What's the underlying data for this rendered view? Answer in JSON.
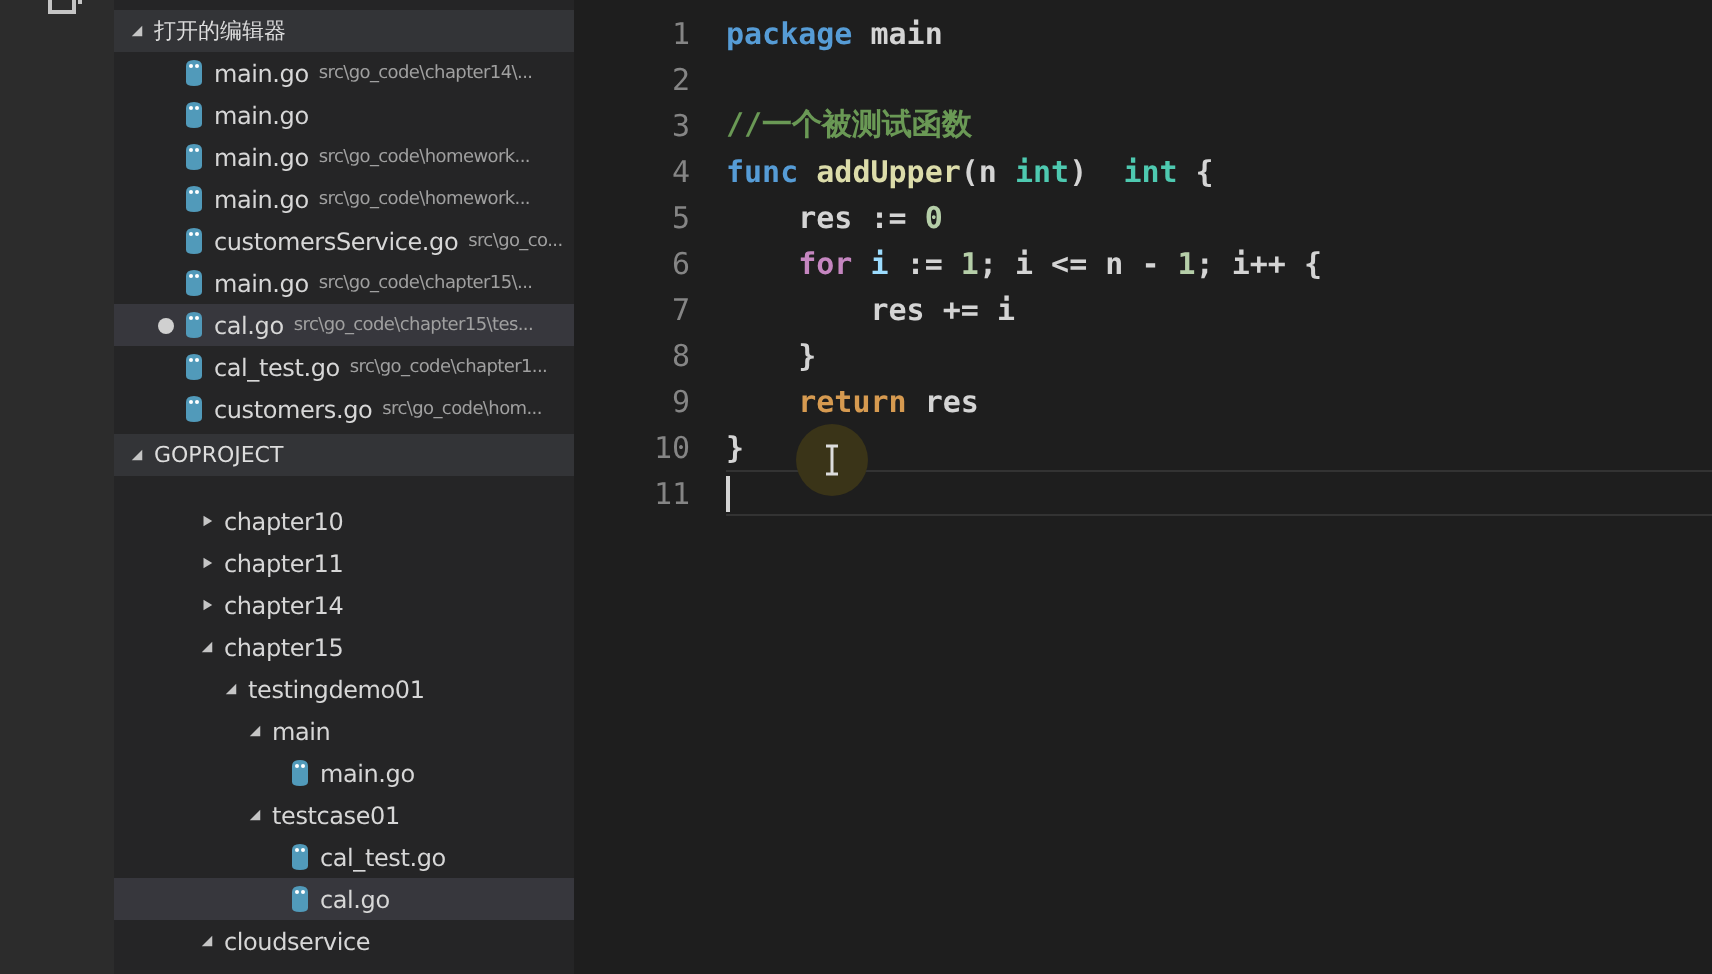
{
  "open_editors": {
    "title": "打开的编辑器",
    "expanded": true,
    "items": [
      {
        "name": "main.go",
        "path": "src\\go_code\\chapter14\\...",
        "modified": false,
        "selected": false
      },
      {
        "name": "main.go",
        "modified": false,
        "selected": false
      },
      {
        "name": "main.go",
        "path": "src\\go_code\\homework...",
        "modified": false,
        "selected": false
      },
      {
        "name": "main.go",
        "path": "src\\go_code\\homework...",
        "modified": false,
        "selected": false
      },
      {
        "name": "customersService.go",
        "path": "src\\go_co...",
        "modified": false,
        "selected": false
      },
      {
        "name": "main.go",
        "path": "src\\go_code\\chapter15\\...",
        "modified": false,
        "selected": false
      },
      {
        "name": "cal.go",
        "path": "src\\go_code\\chapter15\\tes...",
        "modified": true,
        "selected": true
      },
      {
        "name": "cal_test.go",
        "path": "src\\go_code\\chapter1...",
        "modified": false,
        "selected": false
      },
      {
        "name": "customers.go",
        "path": "src\\go_code\\hom...",
        "modified": false,
        "selected": false
      }
    ]
  },
  "project": {
    "title": "GOPROJECT",
    "expanded": true,
    "items": [
      {
        "kind": "folder",
        "name": "chapter10",
        "expanded": false,
        "selected": false
      },
      {
        "kind": "folder",
        "name": "chapter11",
        "expanded": false,
        "selected": false
      },
      {
        "kind": "folder",
        "name": "chapter14",
        "expanded": false,
        "selected": false
      },
      {
        "kind": "folder",
        "name": "chapter15",
        "expanded": true,
        "selected": false,
        "children": [
          {
            "kind": "folder",
            "name": "testingdemo01",
            "expanded": true,
            "selected": false,
            "children": [
              {
                "kind": "folder",
                "name": "main",
                "expanded": true,
                "selected": false,
                "children": [
                  {
                    "kind": "file",
                    "name": "main.go",
                    "selected": false
                  }
                ]
              },
              {
                "kind": "folder",
                "name": "testcase01",
                "expanded": true,
                "selected": false,
                "children": [
                  {
                    "kind": "file",
                    "name": "cal_test.go",
                    "selected": false
                  },
                  {
                    "kind": "file",
                    "name": "cal.go",
                    "selected": true
                  }
                ]
              }
            ]
          }
        ]
      },
      {
        "kind": "folder",
        "name": "cloudservice",
        "expanded": true,
        "selected": false
      }
    ]
  },
  "editor": {
    "lines": [
      {
        "number": "1",
        "tokens": [
          {
            "kind": "keyword",
            "text": "package"
          },
          {
            "kind": "plain",
            "text": " main"
          }
        ]
      },
      {
        "number": "2"
      },
      {
        "number": "3",
        "tokens": [
          {
            "kind": "comment",
            "text": "//一个被测试函数"
          }
        ]
      },
      {
        "number": "4",
        "tokens": [
          {
            "kind": "keyword",
            "text": "func "
          },
          {
            "kind": "function",
            "text": "addUpper"
          },
          {
            "kind": "plain",
            "text": "(n "
          },
          {
            "kind": "type",
            "text": "int"
          },
          {
            "kind": "plain",
            "text": ")  "
          },
          {
            "kind": "type",
            "text": "int"
          },
          {
            "kind": "plain",
            "text": " {"
          }
        ]
      },
      {
        "number": "5",
        "tokens": [
          {
            "kind": "plain",
            "text": "    res := "
          },
          {
            "kind": "number",
            "text": "0"
          }
        ]
      },
      {
        "number": "6",
        "tokens": [
          {
            "kind": "control",
            "text": "    for"
          },
          {
            "kind": "variable",
            "text": " i"
          },
          {
            "kind": "plain",
            "text": " := "
          },
          {
            "kind": "number",
            "text": "1"
          },
          {
            "kind": "plain",
            "text": "; i <= n - "
          },
          {
            "kind": "number",
            "text": "1"
          },
          {
            "kind": "plain",
            "text": "; i++ {"
          }
        ]
      },
      {
        "number": "7",
        "tokens": [
          {
            "kind": "plain",
            "text": "        res += i"
          }
        ]
      },
      {
        "number": "8",
        "tokens": [
          {
            "kind": "plain",
            "text": "    }"
          }
        ]
      },
      {
        "number": "9",
        "tokens": [
          {
            "kind": "return",
            "text": "    return"
          },
          {
            "kind": "plain",
            "text": " res"
          }
        ]
      },
      {
        "number": "10",
        "tokens": [
          {
            "kind": "plain",
            "text": "}"
          }
        ]
      },
      {
        "number": "11",
        "current": true
      }
    ]
  }
}
